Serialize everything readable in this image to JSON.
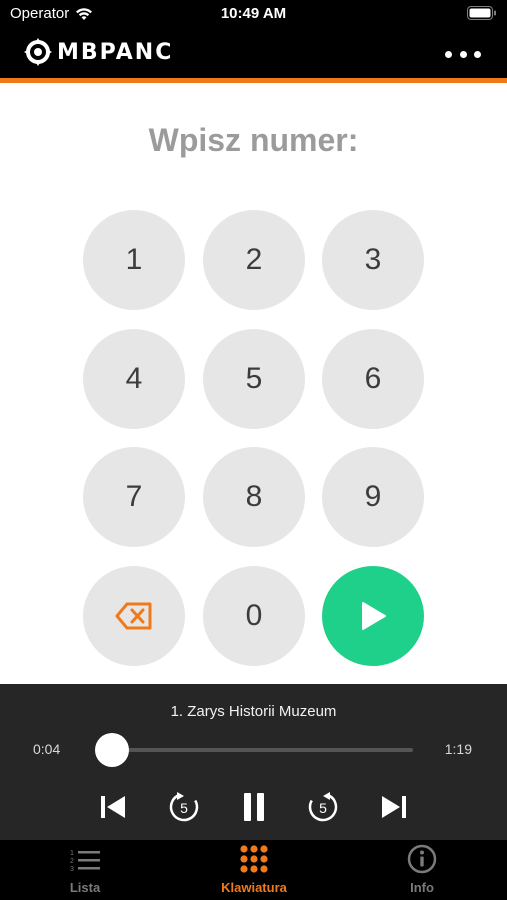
{
  "status_bar": {
    "carrier": "Operator",
    "time": "10:49 AM"
  },
  "header": {
    "logo_text": "MBPANC"
  },
  "prompt": "Wpisz numer:",
  "keypad": {
    "keys": [
      "1",
      "2",
      "3",
      "4",
      "5",
      "6",
      "7",
      "8",
      "9",
      "0"
    ]
  },
  "player": {
    "track_title": "1. Zarys Historii Muzeum",
    "elapsed": "0:04",
    "total": "1:19",
    "progress": 0.05,
    "skip_seconds": "5"
  },
  "tabs": [
    {
      "label": "Lista",
      "icon": "list-icon",
      "active": false
    },
    {
      "label": "Klawiatura",
      "icon": "keypad-icon",
      "active": true
    },
    {
      "label": "Info",
      "icon": "info-icon",
      "active": false
    }
  ],
  "colors": {
    "accent": "#f07a1a",
    "play": "#1fd08a",
    "key_bg": "#e6e6e6",
    "player_bg": "#262626"
  }
}
